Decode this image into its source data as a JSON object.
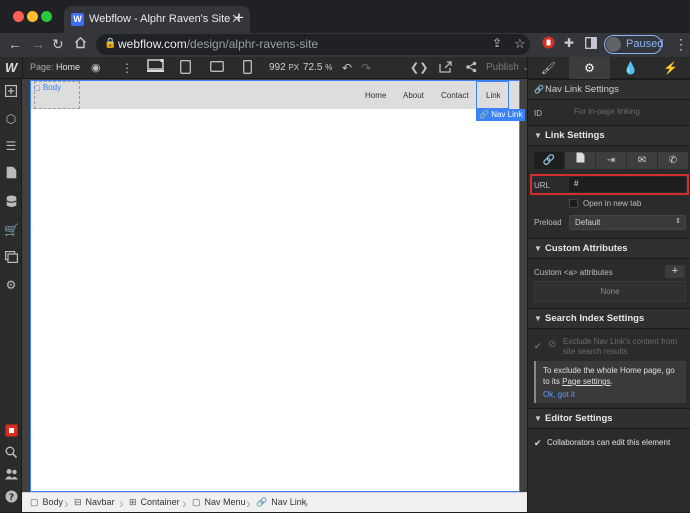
{
  "browser": {
    "tab_title": "Webflow - Alphr Raven's Site",
    "tab_favicon_letter": "W",
    "url_host": "webflow.com",
    "url_path": "/design/alphr-ravens-site",
    "profile_status": "Paused",
    "traffic_lights": [
      "#ff5f57",
      "#febc2e",
      "#28c840"
    ]
  },
  "toolbar": {
    "page_label": "Page:",
    "page_name": "Home",
    "canvas_width": "992",
    "canvas_unit": "PX",
    "zoom": "72.5",
    "zoom_unit": "%",
    "publish_label": "Publish",
    "publish_caret": "⌄"
  },
  "canvas": {
    "body_label": "Body",
    "nav_links": [
      "Home",
      "About",
      "Contact",
      "Link"
    ],
    "selected_tag": "Nav Link"
  },
  "breadcrumbs": [
    {
      "label": "Body",
      "icon": "box-icon"
    },
    {
      "label": "Navbar",
      "icon": "navbar-icon"
    },
    {
      "label": "Container",
      "icon": "container-icon"
    },
    {
      "label": "Nav Menu",
      "icon": "box-icon"
    },
    {
      "label": "Nav Link",
      "icon": "link-icon"
    }
  ],
  "panel": {
    "section_nav_link_settings": "Nav Link Settings",
    "id_label": "ID",
    "id_placeholder": "For in-page linking",
    "section_link_settings": "Link Settings",
    "url_label": "URL",
    "url_value": "#",
    "open_new_tab": "Open in new tab",
    "preload_label": "Preload",
    "preload_value": "Default",
    "section_custom_attributes": "Custom Attributes",
    "custom_attr_label": "Custom <a> attributes",
    "custom_attr_add": "+",
    "custom_attr_empty": "None",
    "section_search_index": "Search Index Settings",
    "exclude_text_line1": "Exclude Nav Link's content from",
    "exclude_text_line2": "site search results",
    "info_line1": "To exclude the whole Home page, go",
    "info_line2_prefix": "to its ",
    "info_line2_link": "Page settings",
    "info_line2_suffix": ".",
    "info_ok": "Ok, got it",
    "section_editor_settings": "Editor Settings",
    "collaborators_text": "Collaborators can edit this element"
  },
  "colors": {
    "accent_blue": "#3b82f6",
    "highlight_red": "#d32f2f",
    "check_green": "#2ea043"
  }
}
